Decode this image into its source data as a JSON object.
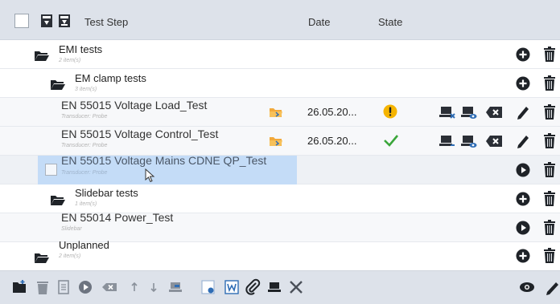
{
  "header": {
    "col_step": "Test Step",
    "col_date": "Date",
    "col_state": "State"
  },
  "rows": [
    {
      "title": "EMI tests",
      "subtitle": "2 item(s)",
      "kind": "group"
    },
    {
      "title": "EM clamp tests",
      "subtitle": "3 item(s)",
      "kind": "group"
    },
    {
      "title": "EN 55015 Voltage Load_Test",
      "subtitle": "Transducer: Probe",
      "date": "26.05.20...",
      "state": "warning"
    },
    {
      "title": "EN 55015 Voltage Control_Test",
      "subtitle": "Transducer: Probe",
      "date": "26.05.20...",
      "state": "ok"
    },
    {
      "title": "EN 55015 Voltage Mains CDNE QP_Test",
      "subtitle": "Transducer: Probe",
      "kind": "dragging"
    },
    {
      "title": "Slidebar tests",
      "subtitle": "1 item(s)",
      "kind": "group"
    },
    {
      "title": "EN 55014 Power_Test",
      "subtitle": "Slidebar",
      "kind": "test"
    },
    {
      "title": "Unplanned",
      "subtitle": "2 item(s)",
      "kind": "group"
    }
  ],
  "colors": {
    "header_bg": "#dde2ea",
    "selection": "#c4dcf7",
    "warning": "#f5b400",
    "ok": "#3aa63a",
    "accent": "#2f6db5"
  }
}
